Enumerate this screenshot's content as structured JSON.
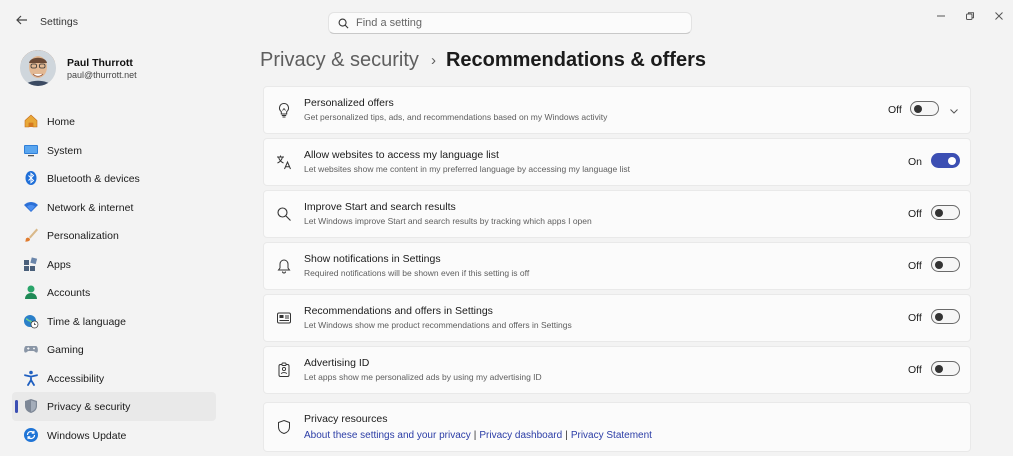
{
  "window": {
    "title": "Settings",
    "search_placeholder": "Find a setting"
  },
  "profile": {
    "name": "Paul Thurrott",
    "email": "paul@thurrott.net"
  },
  "sidebar": {
    "items": [
      {
        "label": "Home",
        "icon": "home-icon",
        "selected": false
      },
      {
        "label": "System",
        "icon": "system-icon",
        "selected": false
      },
      {
        "label": "Bluetooth & devices",
        "icon": "bluetooth-icon",
        "selected": false
      },
      {
        "label": "Network & internet",
        "icon": "network-icon",
        "selected": false
      },
      {
        "label": "Personalization",
        "icon": "brush-icon",
        "selected": false
      },
      {
        "label": "Apps",
        "icon": "apps-icon",
        "selected": false
      },
      {
        "label": "Accounts",
        "icon": "accounts-icon",
        "selected": false
      },
      {
        "label": "Time & language",
        "icon": "globe-clock-icon",
        "selected": false
      },
      {
        "label": "Gaming",
        "icon": "gamepad-icon",
        "selected": false
      },
      {
        "label": "Accessibility",
        "icon": "accessibility-icon",
        "selected": false
      },
      {
        "label": "Privacy & security",
        "icon": "shield-icon",
        "selected": true
      },
      {
        "label": "Windows Update",
        "icon": "update-icon",
        "selected": false
      }
    ]
  },
  "breadcrumb": {
    "parent": "Privacy & security",
    "separator": "›",
    "current": "Recommendations & offers"
  },
  "settings": [
    {
      "title": "Personalized offers",
      "desc": "Get personalized tips, ads, and recommendations based on my Windows activity",
      "state": "Off",
      "on": false,
      "icon": "lightbulb-icon",
      "expandable": true
    },
    {
      "title": "Allow websites to access my language list",
      "desc": "Let websites show me content in my preferred language by accessing my language list",
      "state": "On",
      "on": true,
      "icon": "language-icon",
      "expandable": false
    },
    {
      "title": "Improve Start and search results",
      "desc": "Let Windows improve Start and search results by tracking which apps I open",
      "state": "Off",
      "on": false,
      "icon": "search-icon",
      "expandable": false
    },
    {
      "title": "Show notifications in Settings",
      "desc": "Required notifications will be shown even if this setting is off",
      "state": "Off",
      "on": false,
      "icon": "bell-icon",
      "expandable": false
    },
    {
      "title": "Recommendations and offers in Settings",
      "desc": "Let Windows show me product recommendations and offers in Settings",
      "state": "Off",
      "on": false,
      "icon": "recommendations-icon",
      "expandable": false
    },
    {
      "title": "Advertising ID",
      "desc": "Let apps show me personalized ads by using my advertising ID",
      "state": "Off",
      "on": false,
      "icon": "id-badge-icon",
      "expandable": false
    }
  ],
  "resources": {
    "title": "Privacy resources",
    "links": [
      "About these settings and your privacy",
      "Privacy dashboard",
      "Privacy Statement"
    ],
    "separator": "|"
  },
  "colors": {
    "accent": "#3c4fb3",
    "background": "#f3f3f3",
    "card": "#fbfbfb"
  }
}
